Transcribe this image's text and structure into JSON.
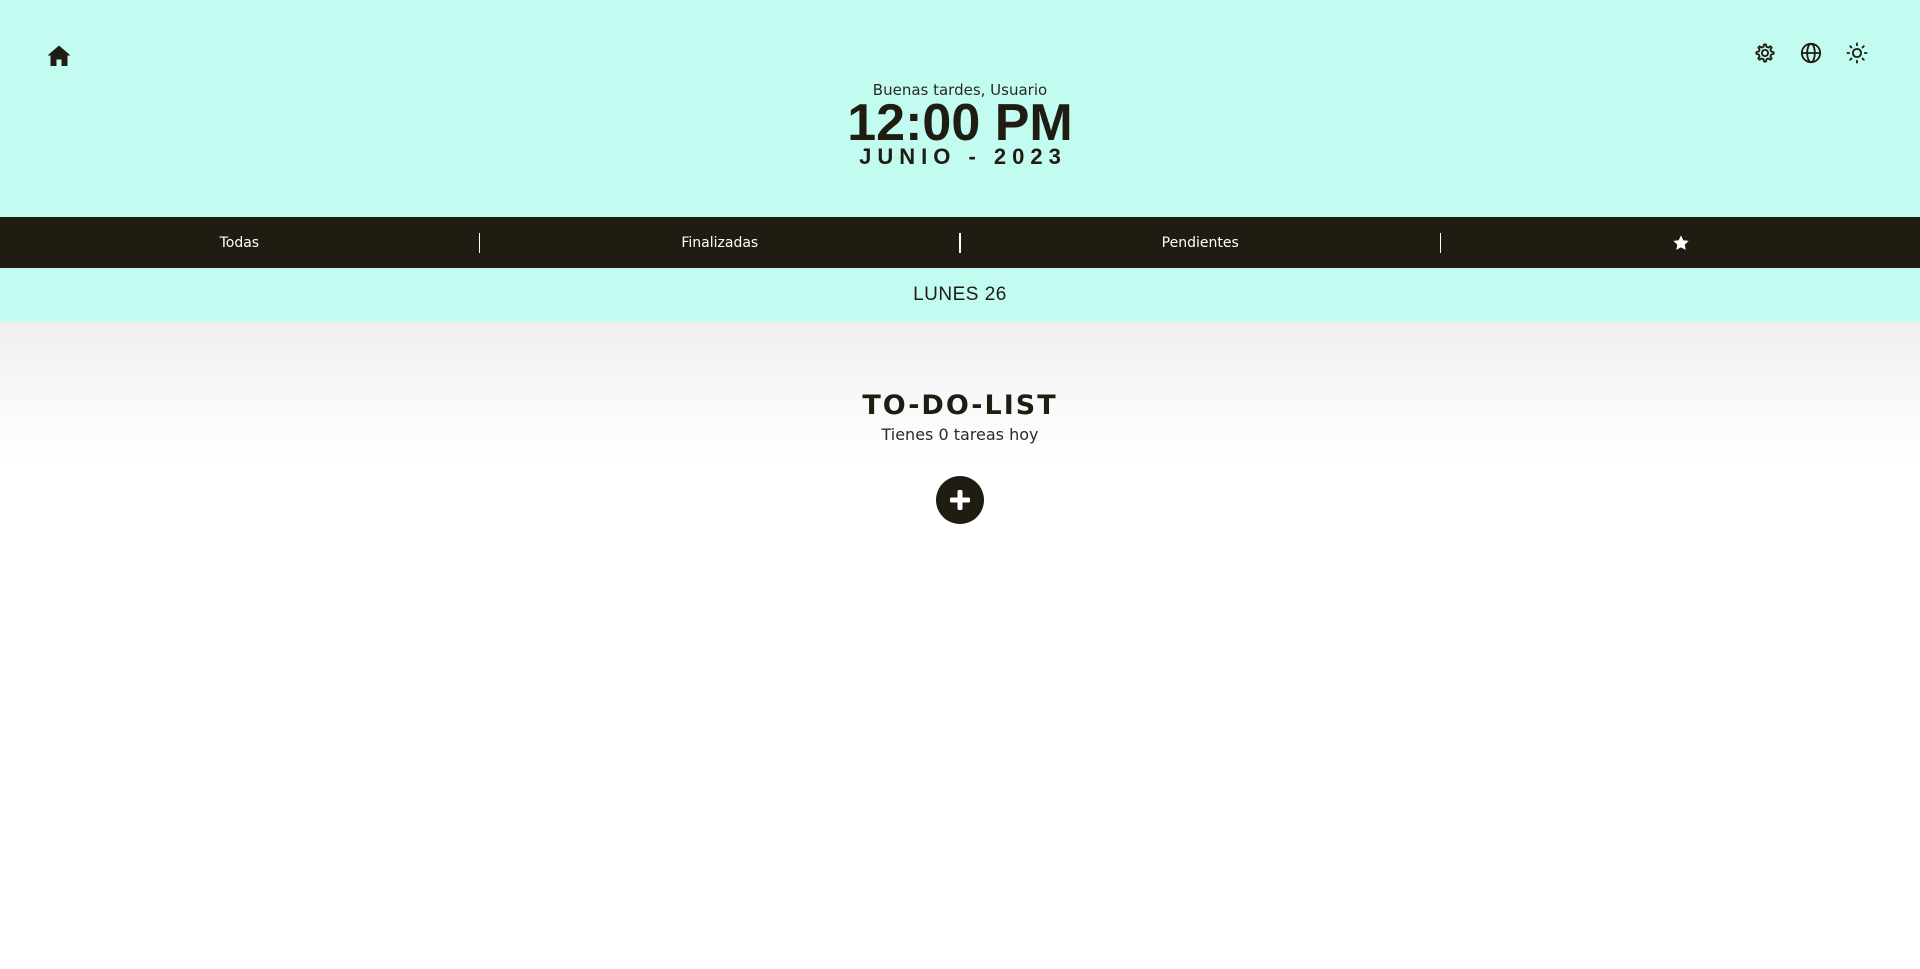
{
  "header": {
    "greeting": "Buenas tardes, Usuario",
    "time": "12:00 PM",
    "month_year": "JUNIO - 2023",
    "icons": {
      "home": "home-icon",
      "settings": "gear-icon",
      "language": "globe-icon",
      "theme": "sun-icon"
    }
  },
  "filters": {
    "all": "Todas",
    "done": "Finalizadas",
    "pending": "Pendientes",
    "favorites_icon": "star-icon"
  },
  "day": {
    "label": "LUNES 26"
  },
  "todo": {
    "title": "TO-DO-LIST",
    "count_text": "Tienes 0 tareas hoy",
    "add_icon": "plus-icon"
  },
  "colors": {
    "accent_bg": "#c2fcf0",
    "dark": "#1f1c12",
    "white": "#ffffff"
  }
}
